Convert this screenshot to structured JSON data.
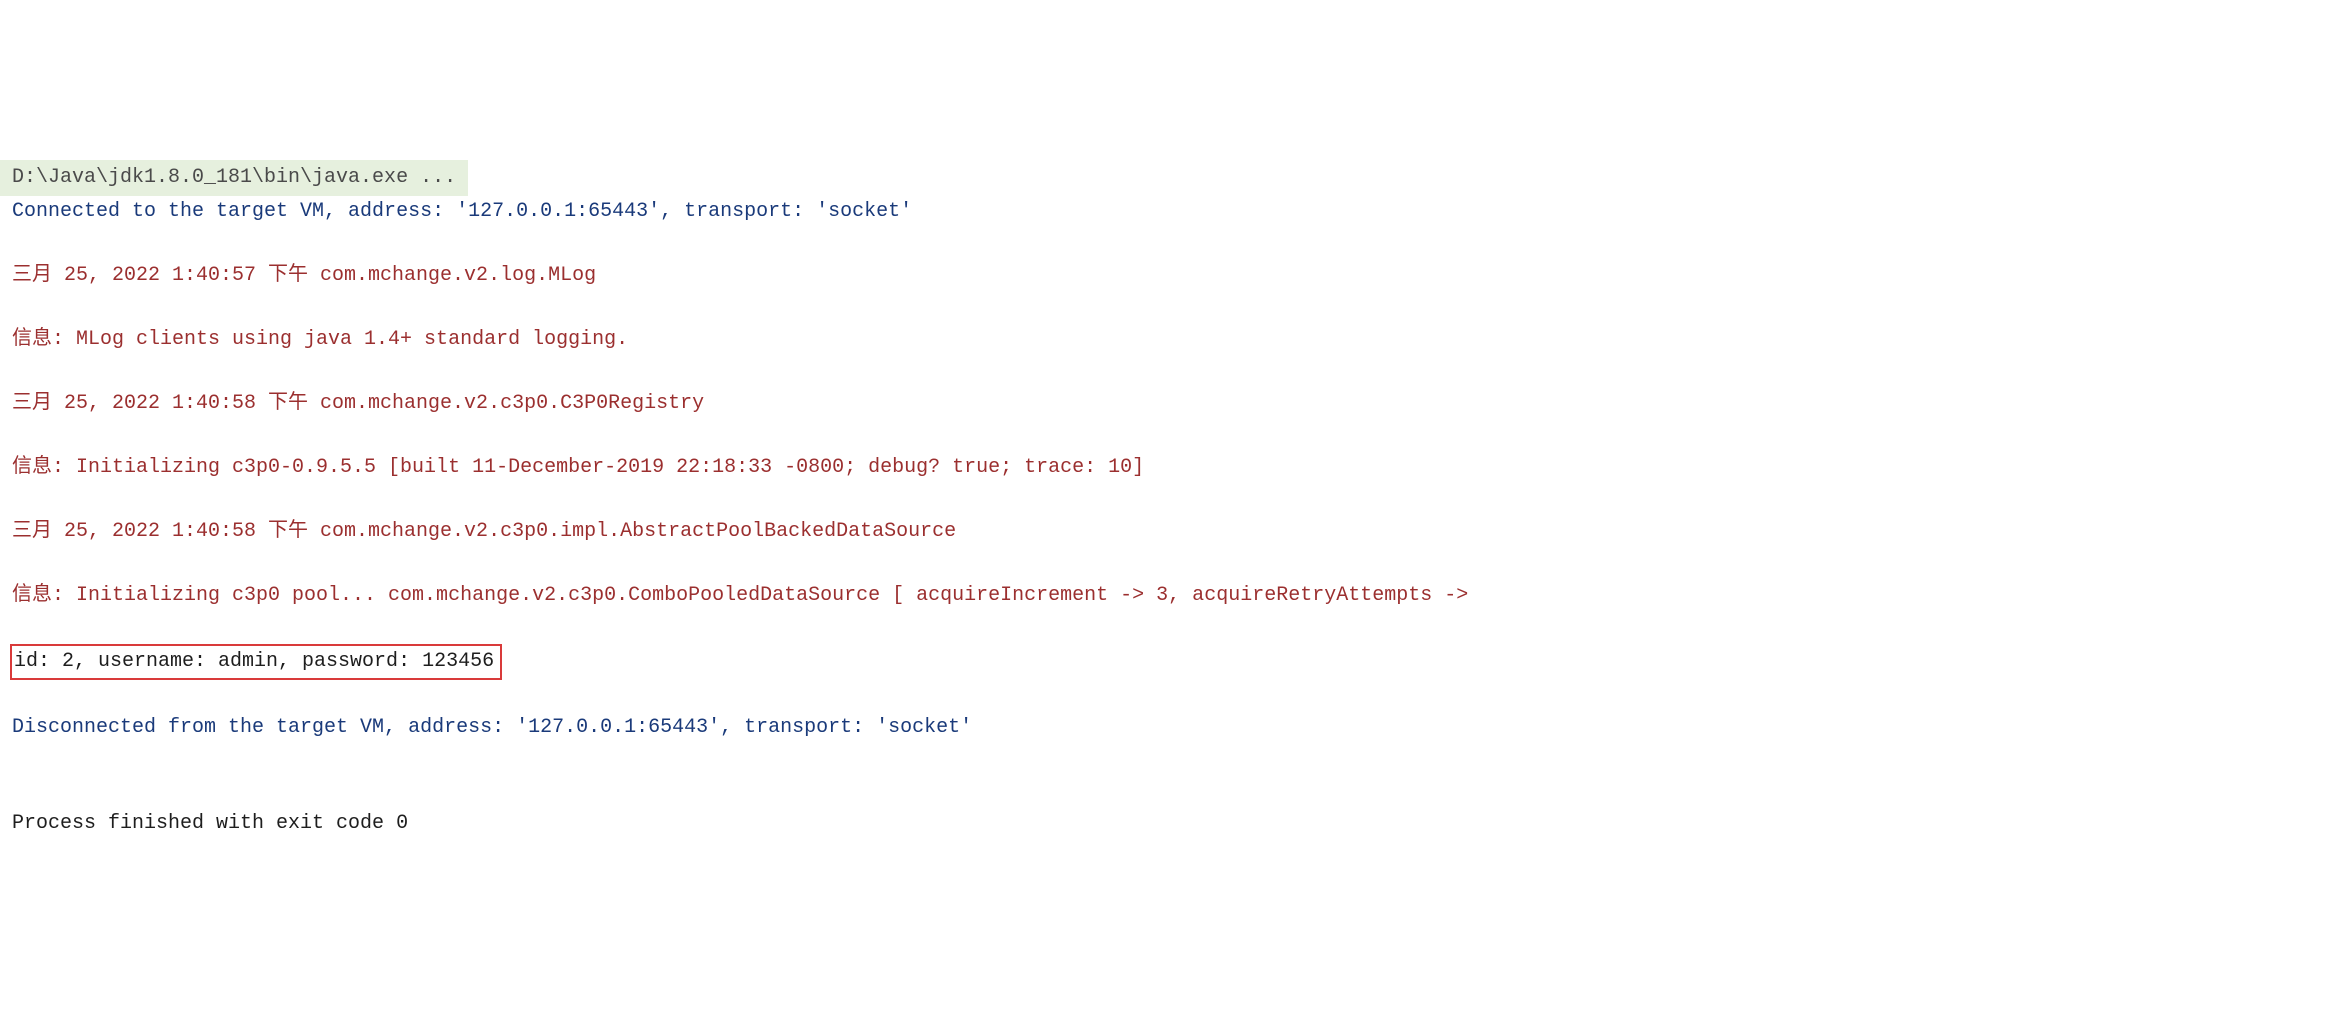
{
  "console": {
    "command_line": "D:\\Java\\jdk1.8.0_181\\bin\\java.exe ...",
    "connected": "Connected to the target VM, address: '127.0.0.1:65443', transport: 'socket'",
    "log1": "三月 25, 2022 1:40:57 下午 com.mchange.v2.log.MLog",
    "log2": "信息: MLog clients using java 1.4+ standard logging.",
    "log3": "三月 25, 2022 1:40:58 下午 com.mchange.v2.c3p0.C3P0Registry",
    "log4": "信息: Initializing c3p0-0.9.5.5 [built 11-December-2019 22:18:33 -0800; debug? true; trace: 10]",
    "log5": "三月 25, 2022 1:40:58 下午 com.mchange.v2.c3p0.impl.AbstractPoolBackedDataSource",
    "log6": "信息: Initializing c3p0 pool... com.mchange.v2.c3p0.ComboPooledDataSource [ acquireIncrement -> 3, acquireRetryAttempts -> ",
    "output": "id: 2, username: admin, password: 123456",
    "disconnected": "Disconnected from the target VM, address: '127.0.0.1:65443', transport: 'socket'",
    "empty": "",
    "exit": "Process finished with exit code 0"
  }
}
